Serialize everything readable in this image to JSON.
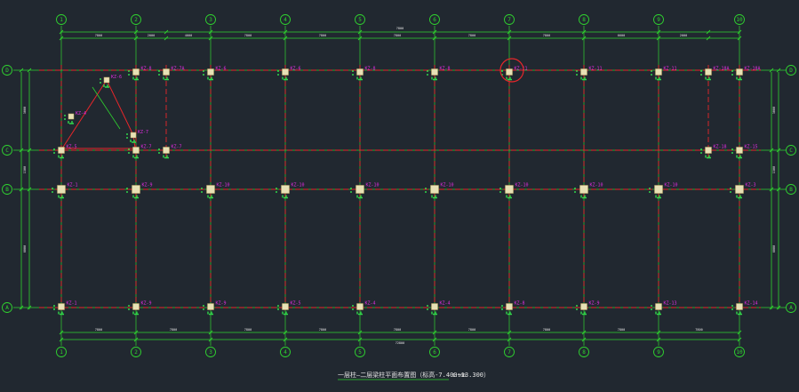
{
  "drawing": {
    "title": "一层柱—二层梁柱平面布置图（标高-7.400~13.300）",
    "scale": "1:100",
    "colors": {
      "background": "#212830",
      "grid_line": "#e8262a",
      "axis_bubble": "#2fd42f",
      "dimension": "#2fd42f",
      "column_label": "#e22ce2",
      "column_fill": "#e7e1b5",
      "rebar": "#31d84a",
      "highlight": "#e8262a"
    }
  },
  "axes": {
    "vertical": [
      "1",
      "2",
      "3",
      "4",
      "5",
      "6",
      "7",
      "8",
      "9",
      "10"
    ],
    "horizontal": [
      "D",
      "C",
      "B",
      "A"
    ]
  },
  "dimensions": {
    "top_overall": "7800",
    "top_segments": [
      "7800",
      "2000",
      "4000",
      "7800",
      "7800",
      "7800",
      "7800",
      "7800",
      "6600",
      "2000"
    ],
    "bottom_overall": "72800",
    "bottom_segments": [
      "7800",
      "7800",
      "7800",
      "7800",
      "7800",
      "7800",
      "7800",
      "7800",
      "7800"
    ],
    "left_segments": [
      "3000",
      "1300",
      "6000"
    ],
    "right_segments": [
      "3000",
      "1300",
      "6000"
    ]
  },
  "columns": {
    "row_D": [
      "KZ-8",
      "KZ-7A",
      "KZ-6",
      "KZ-6",
      "KZ-8",
      "KZ-8",
      "KZ-11",
      "KZ-11",
      "KZ-11",
      "KZ-18A",
      "KZ-18A"
    ],
    "row_C": [
      "KZ-5",
      "KZ-7",
      "KZ-7",
      "KZ-18",
      "KZ-15"
    ],
    "row_B": [
      "KZ-1",
      "KZ-9",
      "KZ-10",
      "KZ-10",
      "KZ-10",
      "KZ-10",
      "KZ-10",
      "KZ-10",
      "KZ-10",
      "KZ-3"
    ],
    "row_A": [
      "KZ-1",
      "KZ-9",
      "KZ-9",
      "KZ-5",
      "KZ-4",
      "KZ-4",
      "KZ-8",
      "KZ-9",
      "KZ-13",
      "KZ-14"
    ],
    "angled": [
      "KZ-6",
      "KZ-4",
      "KZ-7"
    ]
  }
}
